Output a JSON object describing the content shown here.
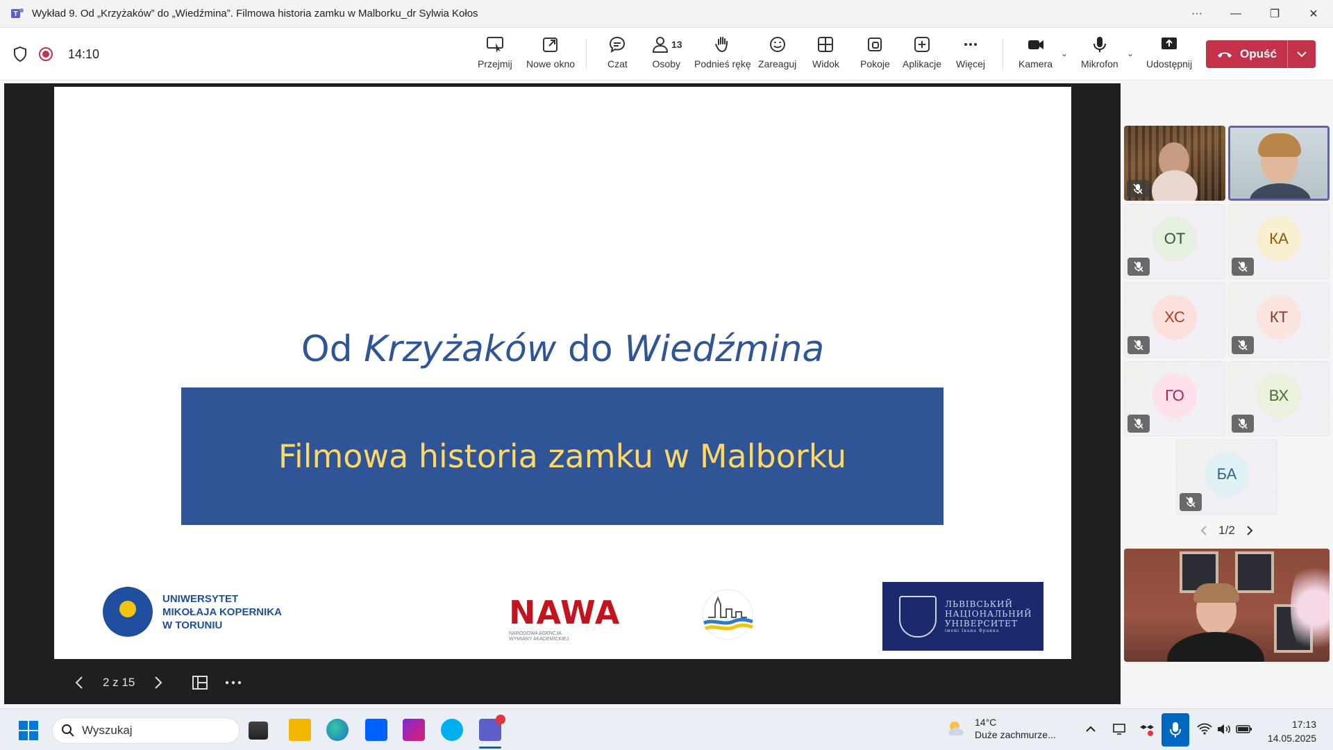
{
  "window": {
    "title": "Wykład 9. Od „Krzyżaków” do „Wiedźmina”. Filmowa historia zamku w Malborku_dr Sylwia Kołos",
    "controls": {
      "more": "···",
      "minimize": "—",
      "maximize": "❐",
      "close": "✕"
    }
  },
  "toolbar": {
    "meeting_time": "14:10",
    "buttons": {
      "take_control": "Przejmij",
      "new_window": "Nowe okno",
      "chat": "Czat",
      "people": "Osoby",
      "people_count": "13",
      "raise_hand": "Podnieś rękę",
      "react": "Zareaguj",
      "view": "Widok",
      "rooms": "Pokoje",
      "apps": "Aplikacje",
      "more": "Więcej",
      "camera": "Kamera",
      "mic": "Mikrofon",
      "share": "Udostępnij",
      "leave": "Opuść"
    }
  },
  "slide": {
    "title_plain_1": "Od ",
    "title_italic_1": "Krzyżaków",
    "title_plain_2": " do ",
    "title_italic_2": "Wiedźmina",
    "subtitle": "Filmowa historia zamku w Malborku",
    "logos": {
      "umk_line1": "UNIWERSYTET",
      "umk_line2": "MIKOŁAJA KOPERNIKA",
      "umk_line3": "W TORUNIU",
      "nawa": "NAWA",
      "nawa_small_1": "NARODOWA AGENCJA",
      "nawa_small_2": "WYMIANY AKADEMICKIEJ",
      "lviv_line1": "ЛЬВІВСЬКИЙ",
      "lviv_line2": "НАЦІОНАЛЬНИЙ",
      "lviv_line3": "УНІВЕРСИТЕТ",
      "lviv_line4": "імені Івана Франка"
    },
    "nav": {
      "counter": "2 z 15"
    }
  },
  "participants": [
    {
      "initials": "ОТ",
      "bg": "#e6f0e1",
      "fg": "#2e5a2e"
    },
    {
      "initials": "КА",
      "bg": "#fbefd2",
      "fg": "#8a5a00"
    },
    {
      "initials": "ХС",
      "bg": "#fbe0dc",
      "fg": "#b23a2a"
    },
    {
      "initials": "КТ",
      "bg": "#fbe3de",
      "fg": "#8a3a2a"
    },
    {
      "initials": "ГО",
      "bg": "#fde0ea",
      "fg": "#b0205a"
    },
    {
      "initials": "ВХ",
      "bg": "#eaf2dd",
      "fg": "#4a6a2a"
    },
    {
      "initials": "БА",
      "bg": "#dff1f4",
      "fg": "#2a6a7a"
    }
  ],
  "pager": {
    "label": "1/2"
  },
  "taskbar": {
    "search_placeholder": "Wyszukaj",
    "weather_temp": "14°C",
    "weather_desc": "Duże zachmurze...",
    "time": "17:13",
    "date": "14.05.2025"
  },
  "colors": {
    "accent": "#6264a7",
    "leave": "#c4314b",
    "slide_blue": "#2f5597",
    "slide_yellow": "#ffd966"
  }
}
